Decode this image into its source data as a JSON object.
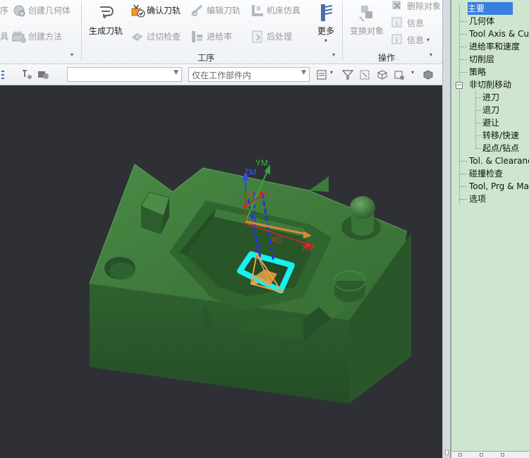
{
  "ribbon": {
    "group_process": {
      "label": "工序",
      "generate_toolpath": "生成刀轨",
      "verify_toolpath": "确认刀轨",
      "edit_toolpath": "编辑刀轨",
      "machine_simulation": "机床仿真",
      "gouge_check": "过切检查",
      "feeds": "进给率",
      "postprocess": "后处理",
      "more": "更多"
    },
    "group_insert": {
      "cut_left_1": "序",
      "cut_left_2": "具",
      "create_geometry": "创建几何体",
      "create_method": "创建方法"
    },
    "group_actions": {
      "label": "操作",
      "transform_object": "变换对象",
      "delete_object": "删除对象",
      "info_1": "信息",
      "info_2": "信息"
    }
  },
  "toolbar": {
    "filter_combo": {
      "value": ""
    },
    "scope_combo": {
      "value": "仅在工作部件内"
    }
  },
  "viewport": {
    "axis_labels": {
      "ym": "YM",
      "zm": "ZM",
      "xm": "XM",
      "xc": "XC",
      "zc": "ZC"
    },
    "colors": {
      "background": "#2e3035",
      "part": "#3e7a3e",
      "highlight": "#19f0f0"
    }
  },
  "navigator": {
    "items": [
      {
        "label": "主要",
        "selected": true
      },
      {
        "label": "几何体"
      },
      {
        "label": "Tool Axis & Cu"
      },
      {
        "label": "进给率和速度"
      },
      {
        "label": "切削层"
      },
      {
        "label": "策略"
      },
      {
        "label": "非切削移动",
        "expanded": true
      },
      {
        "label": "进刀",
        "child": true
      },
      {
        "label": "退刀",
        "child": true
      },
      {
        "label": "避让",
        "child": true
      },
      {
        "label": "转移/快速",
        "child": true
      },
      {
        "label": "起点/钻点",
        "child": true
      },
      {
        "label": "Tol. & Clearanc"
      },
      {
        "label": "碰撞检查"
      },
      {
        "label": "Tool, Prg & Ma"
      },
      {
        "label": "选项"
      }
    ]
  }
}
